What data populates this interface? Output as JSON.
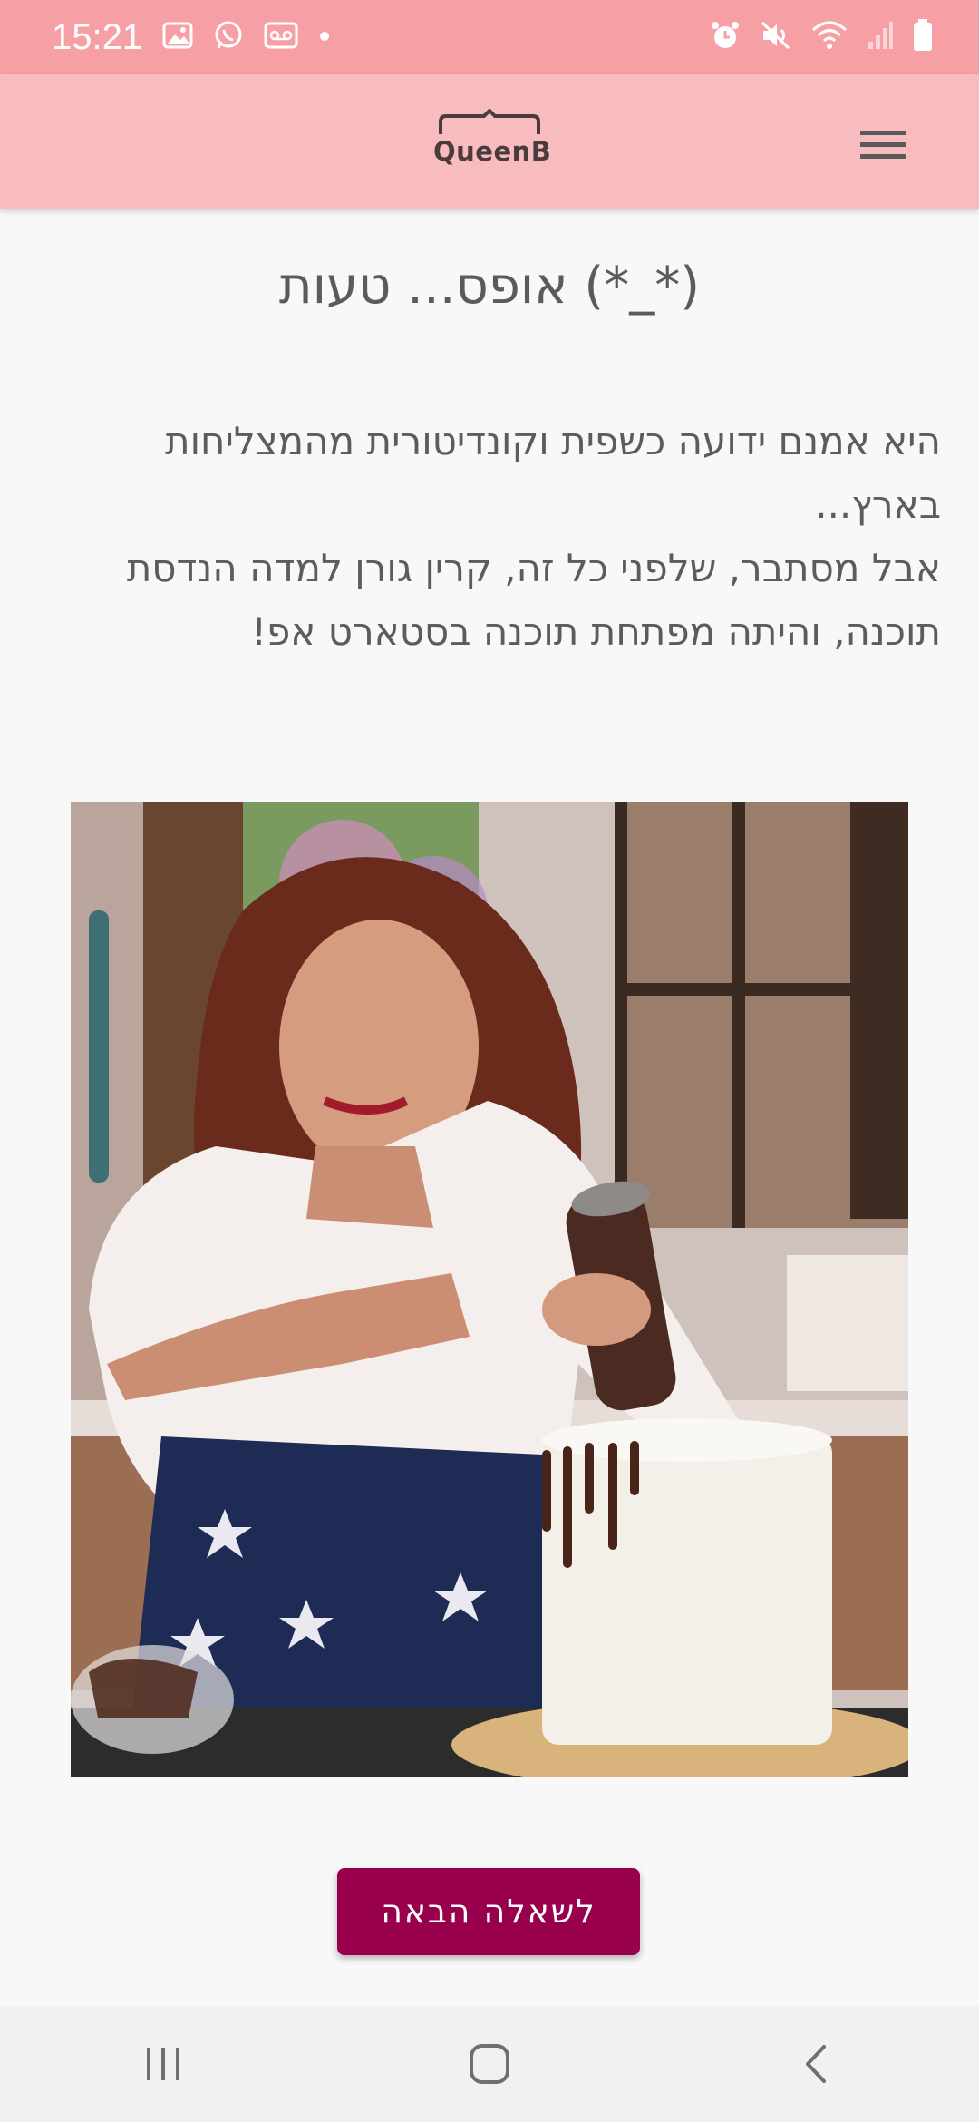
{
  "status_bar": {
    "time": "15:21",
    "left_icons": [
      "gallery-icon",
      "whatsapp-icon",
      "voicemail-icon",
      "dot-icon"
    ],
    "right_icons": [
      "alarm-icon",
      "mute-icon",
      "wifi-icon",
      "signal-icon",
      "battery-icon"
    ]
  },
  "app_bar": {
    "logo_text": "QueenB",
    "menu_icon": "hamburger-menu-icon"
  },
  "main": {
    "title": "אופס... טעות (*_*)",
    "body": "היא אמנם ידועה כשפית וקונדיטורית מהמצליחות בארץ...\nאבל מסתבר, שלפני כל זה, קרין גורן למדה הנדסת תוכנה, והיתה מפתחת תוכנה בסטארט אפ!",
    "photo": "photo of a woman drizzling chocolate on a white cake",
    "next_button_label": "לשאלה הבאה"
  },
  "nav_bar": {
    "icons": [
      "recent-apps-icon",
      "home-icon",
      "back-icon"
    ]
  },
  "colors": {
    "status_bar": "#f6a0a6",
    "app_bar": "#f9bcbe",
    "button": "#98004d",
    "background": "#f8f8f8"
  }
}
